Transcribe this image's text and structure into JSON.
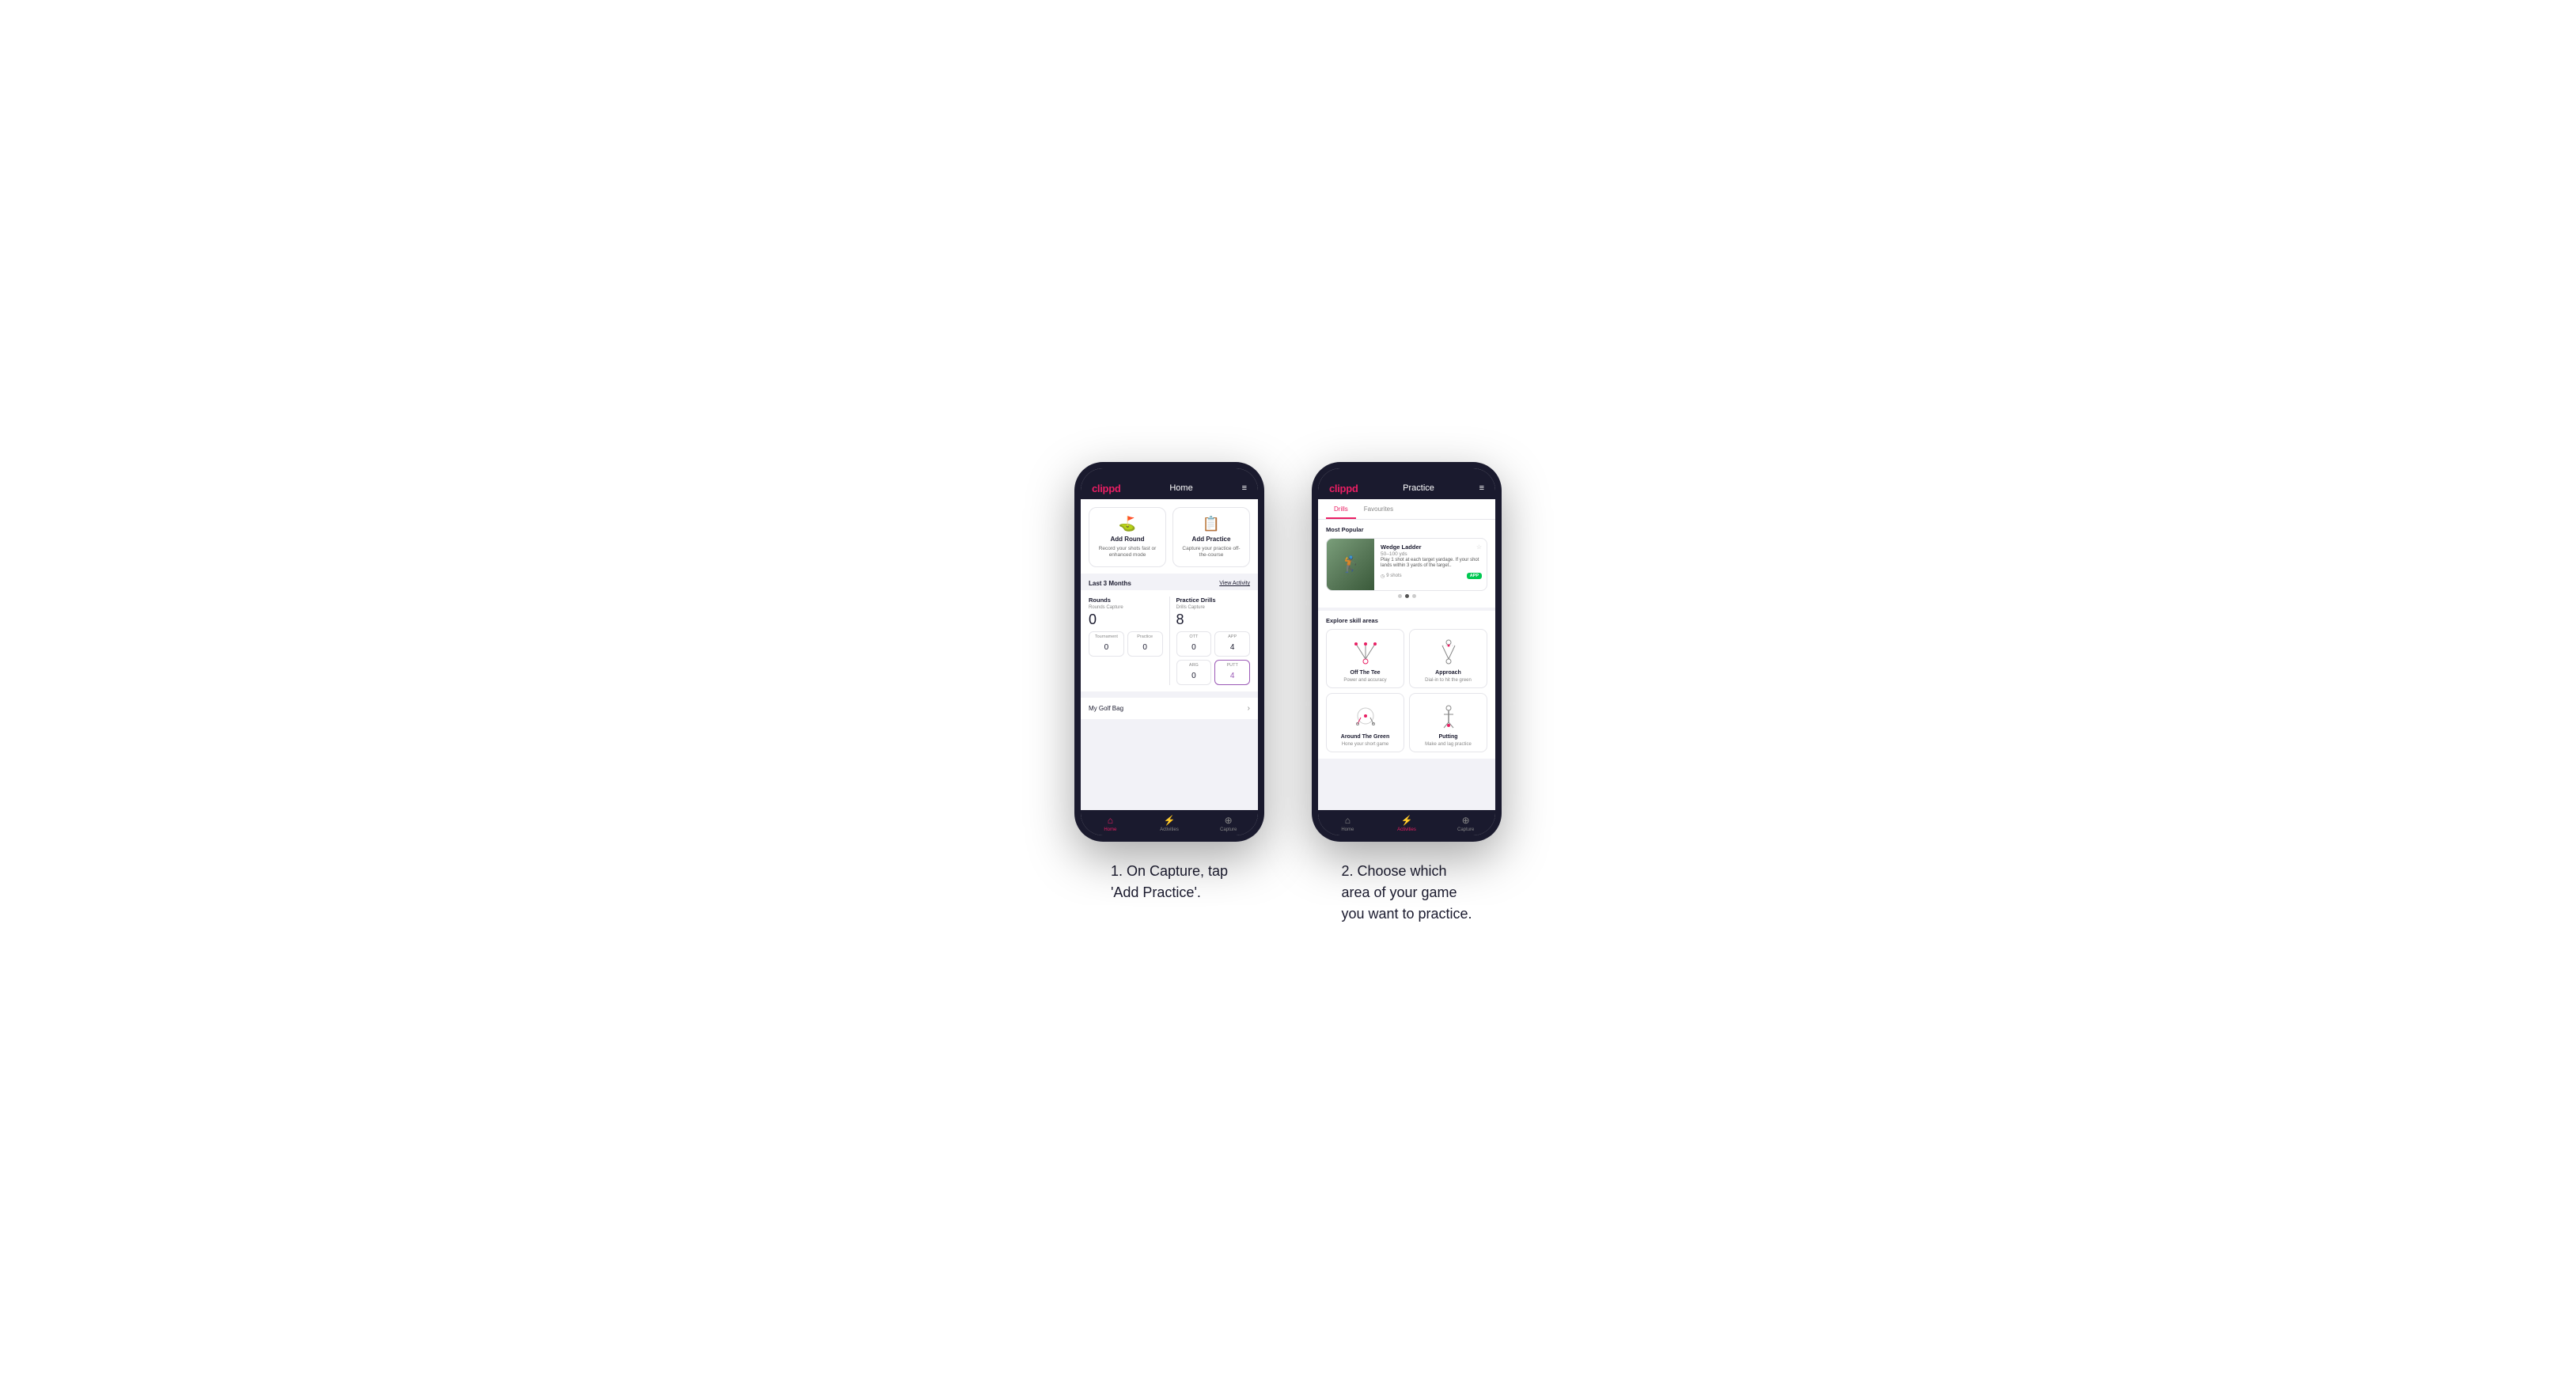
{
  "page": {
    "background": "#ffffff"
  },
  "phone1": {
    "header": {
      "logo": "clippd",
      "title": "Home",
      "menu_icon": "≡"
    },
    "action_cards": [
      {
        "id": "add-round",
        "icon": "⛳",
        "title": "Add Round",
        "subtitle": "Record your shots fast or enhanced mode"
      },
      {
        "id": "add-practice",
        "icon": "📋",
        "title": "Add Practice",
        "subtitle": "Capture your practice off-the-course"
      }
    ],
    "last3months": {
      "label": "Last 3 Months",
      "view_activity": "View Activity"
    },
    "rounds_section": {
      "title": "Rounds",
      "rounds_capture_label": "Rounds Capture",
      "rounds_capture_value": "0",
      "tournament_label": "Tournament",
      "tournament_value": "0",
      "practice_label": "Practice",
      "practice_value": "0"
    },
    "practice_drills_section": {
      "title": "Practice Drills",
      "drills_capture_label": "Drills Capture",
      "drills_capture_value": "8",
      "ott_label": "OTT",
      "ott_value": "0",
      "app_label": "APP",
      "app_value": "4",
      "arg_label": "ARG",
      "arg_value": "0",
      "putt_label": "PUTT",
      "putt_value": "4"
    },
    "golf_bag": {
      "label": "My Golf Bag"
    },
    "bottom_nav": [
      {
        "icon": "🏠",
        "label": "Home",
        "active": true
      },
      {
        "icon": "⚡",
        "label": "Activities",
        "active": false
      },
      {
        "icon": "➕",
        "label": "Capture",
        "active": false
      }
    ]
  },
  "phone2": {
    "header": {
      "logo": "clippd",
      "title": "Practice",
      "menu_icon": "≡"
    },
    "tabs": [
      {
        "label": "Drills",
        "active": true
      },
      {
        "label": "Favourites",
        "active": false
      }
    ],
    "most_popular": {
      "section_title": "Most Popular",
      "drill": {
        "title": "Wedge Ladder",
        "yardage": "50–100 yds",
        "description": "Play 1 shot at each target yardage. If your shot lands within 3 yards of the target..",
        "shots": "9 shots",
        "badge": "APP"
      },
      "dots": [
        {
          "active": false
        },
        {
          "active": true
        },
        {
          "active": false
        }
      ]
    },
    "explore_skill_areas": {
      "section_title": "Explore skill areas",
      "skills": [
        {
          "name": "Off The Tee",
          "description": "Power and accuracy",
          "diagram_type": "tee"
        },
        {
          "name": "Approach",
          "description": "Dial-in to hit the green",
          "diagram_type": "approach"
        },
        {
          "name": "Around The Green",
          "description": "Hone your short game",
          "diagram_type": "around-green"
        },
        {
          "name": "Putting",
          "description": "Make and lag practice",
          "diagram_type": "putting"
        }
      ]
    },
    "bottom_nav": [
      {
        "icon": "🏠",
        "label": "Home",
        "active": false
      },
      {
        "icon": "⚡",
        "label": "Activities",
        "active": true
      },
      {
        "icon": "➕",
        "label": "Capture",
        "active": false
      }
    ]
  },
  "captions": {
    "phone1_caption": "1. On Capture, tap\n'Add Practice'.",
    "phone2_caption": "2. Choose which\narea of your game\nyou want to practice."
  }
}
